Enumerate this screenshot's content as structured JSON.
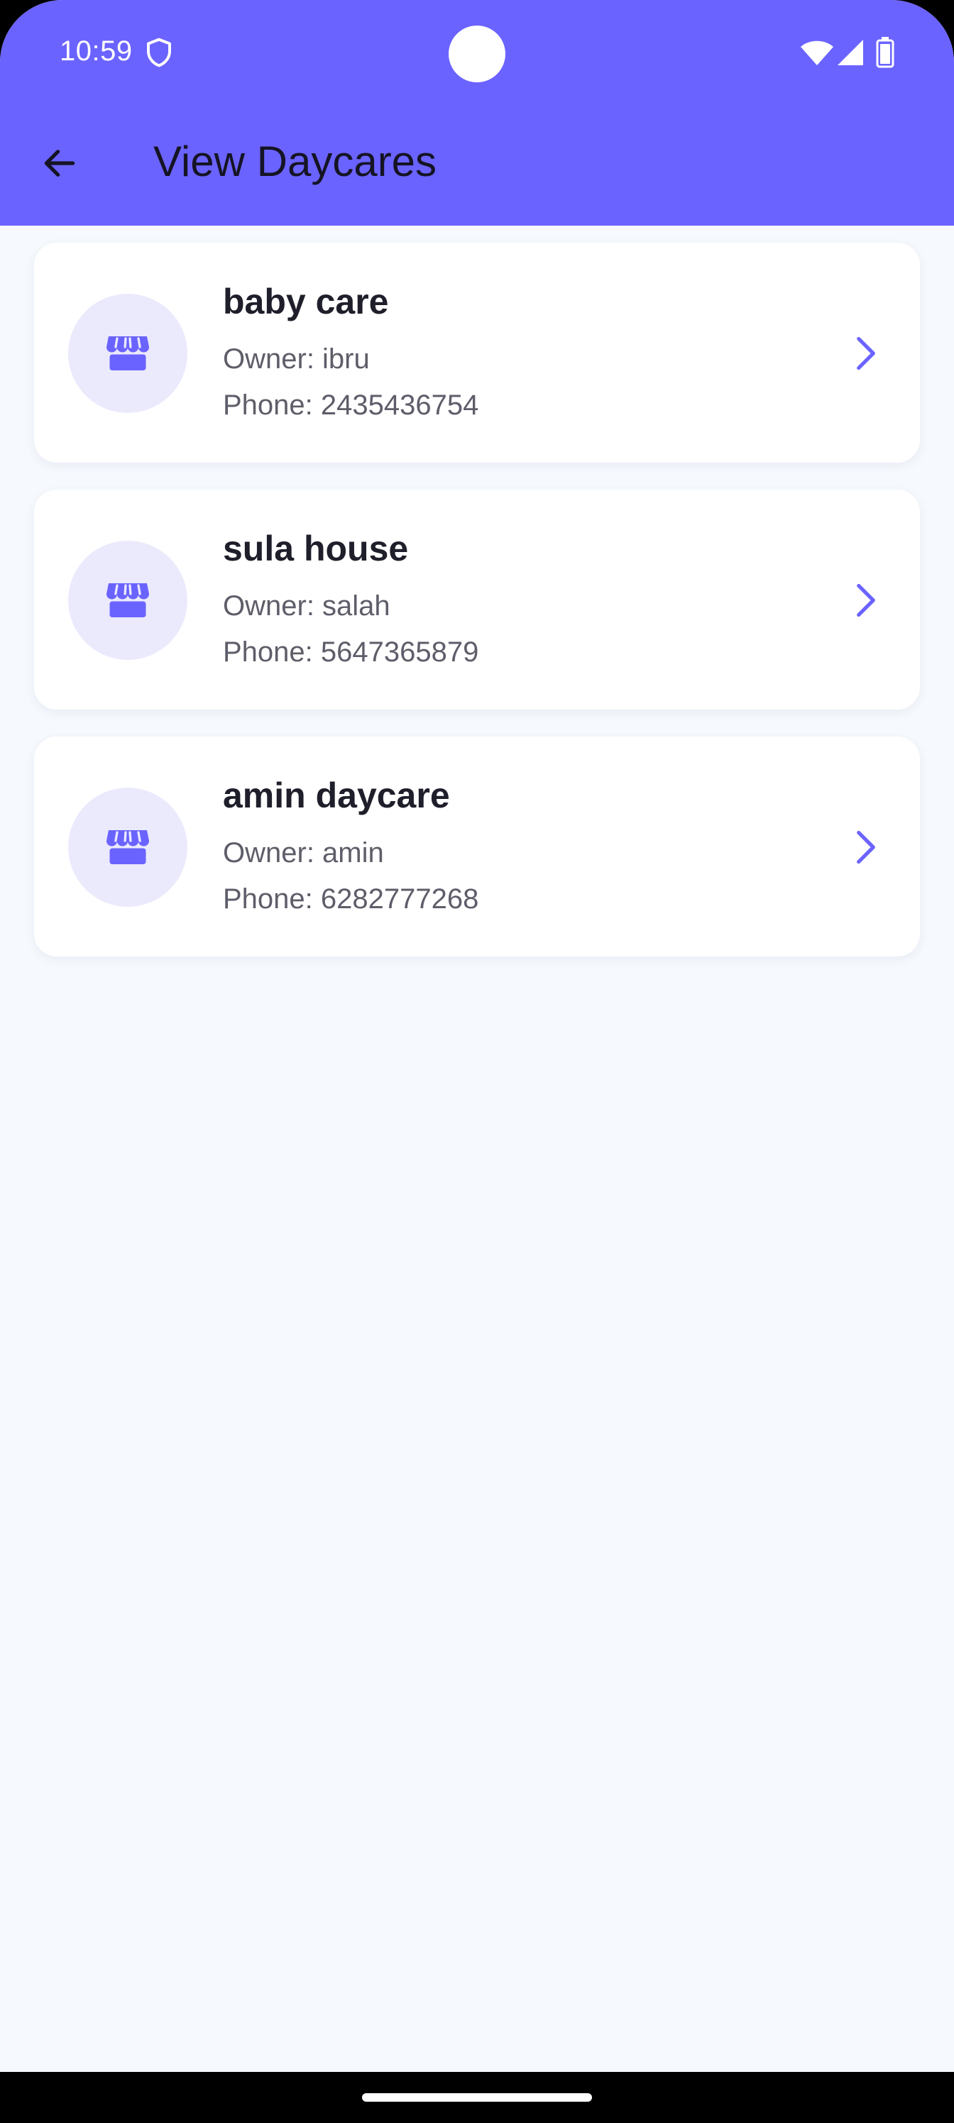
{
  "status_bar": {
    "time": "10:59"
  },
  "app_bar": {
    "title": "View Daycares"
  },
  "daycares": [
    {
      "name": "baby care",
      "owner": "Owner: ibru",
      "phone": "Phone: 2435436754"
    },
    {
      "name": "sula house",
      "owner": "Owner: salah",
      "phone": "Phone: 5647365879"
    },
    {
      "name": "amin daycare",
      "owner": "Owner: amin",
      "phone": "Phone: 6282777268"
    }
  ],
  "icons": {
    "back": "arrow-left-icon",
    "item": "storefront-icon",
    "chevron": "chevron-right-icon"
  },
  "colors": {
    "primary": "#6b63ff",
    "background": "#f6f9fd",
    "avatar_bg": "#ebeafd"
  }
}
